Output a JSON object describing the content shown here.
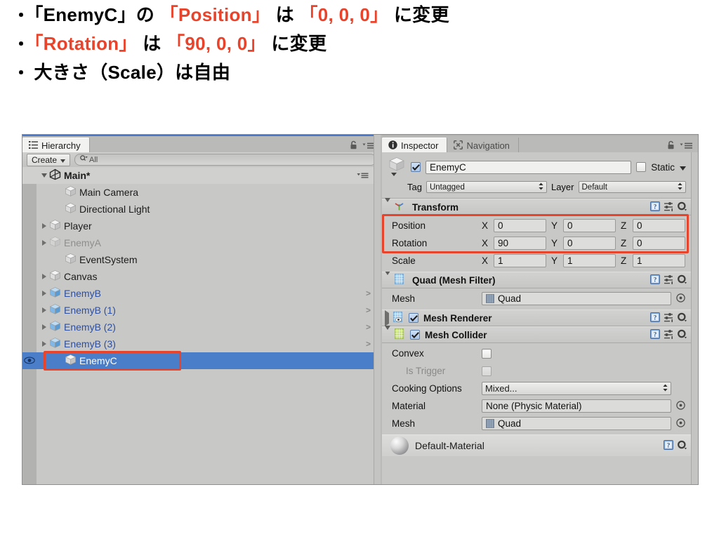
{
  "slide": {
    "lines": [
      {
        "dot": "・",
        "segments": [
          {
            "t": "「EnemyC」の ",
            "c": "black"
          },
          {
            "t": "「Position」",
            "c": "red"
          },
          {
            "t": " は ",
            "c": "black"
          },
          {
            "t": "「0, 0, 0」",
            "c": "red"
          },
          {
            "t": " に変更",
            "c": "black"
          }
        ]
      },
      {
        "dot": "・",
        "segments": [
          {
            "t": "「Rotation」",
            "c": "red"
          },
          {
            "t": " は ",
            "c": "black"
          },
          {
            "t": "「90, 0, 0」",
            "c": "red"
          },
          {
            "t": " に変更",
            "c": "black"
          }
        ]
      },
      {
        "dot": "・",
        "segments": [
          {
            "t": "大きさ（Scale）は自由",
            "c": "black"
          }
        ]
      }
    ]
  },
  "colors": {
    "accent_red": "#e8432b",
    "selection_blue": "#4a7ec8",
    "prefab_blue": "#2d4f9e",
    "panel_gray": "#c8c8c7"
  },
  "hierarchy": {
    "tab_label": "Hierarchy",
    "tab_icon": "hierarchy-icon",
    "lock_icon": "lock-icon",
    "menu_icon": "hamburger-menu-icon",
    "create_label": "Create",
    "search_placeholder": "All",
    "search_value": "All",
    "search_icon": "search-icon",
    "scene_label": "Main*",
    "items": [
      {
        "label": "Main Camera",
        "indent": 2,
        "foldout": "none",
        "style": "normal",
        "prefab_arrow": false
      },
      {
        "label": "Directional Light",
        "indent": 2,
        "foldout": "none",
        "style": "normal",
        "prefab_arrow": false
      },
      {
        "label": "Player",
        "indent": 1,
        "foldout": "right",
        "style": "normal",
        "prefab_arrow": false
      },
      {
        "label": "EnemyA",
        "indent": 1,
        "foldout": "right",
        "style": "dim",
        "prefab_arrow": false
      },
      {
        "label": "EventSystem",
        "indent": 2,
        "foldout": "none",
        "style": "normal",
        "prefab_arrow": false
      },
      {
        "label": "Canvas",
        "indent": 1,
        "foldout": "right",
        "style": "normal",
        "prefab_arrow": false
      },
      {
        "label": "EnemyB",
        "indent": 1,
        "foldout": "right",
        "style": "prefab",
        "prefab_arrow": true
      },
      {
        "label": "EnemyB (1)",
        "indent": 1,
        "foldout": "right",
        "style": "prefab",
        "prefab_arrow": true
      },
      {
        "label": "EnemyB (2)",
        "indent": 1,
        "foldout": "right",
        "style": "prefab",
        "prefab_arrow": true
      },
      {
        "label": "EnemyB (3)",
        "indent": 1,
        "foldout": "right",
        "style": "prefab",
        "prefab_arrow": true
      },
      {
        "label": "EnemyC",
        "indent": 2,
        "foldout": "none",
        "style": "selected",
        "prefab_arrow": false
      }
    ]
  },
  "inspector": {
    "tabs": [
      {
        "label": "Inspector",
        "icon": "info-icon",
        "active": true
      },
      {
        "label": "Navigation",
        "icon": "navigation-icon",
        "active": false
      }
    ],
    "lock_icon": "lock-icon",
    "menu_icon": "hamburger-menu-icon",
    "object": {
      "enabled": true,
      "name": "EnemyC",
      "static_label": "Static",
      "static_checked": false,
      "tag_label": "Tag",
      "tag_value": "Untagged",
      "layer_label": "Layer",
      "layer_value": "Default"
    },
    "components": [
      {
        "name": "Transform",
        "icon": "transform-axis-icon",
        "expanded": true,
        "has_toggle": false,
        "help_icon": "help-book-icon",
        "preset_icon": "preset-icon",
        "gear_icon": "gear-icon"
      },
      {
        "name": "Quad (Mesh Filter)",
        "icon": "mesh-filter-icon",
        "expanded": true,
        "has_toggle": false,
        "help_icon": "help-book-icon",
        "preset_icon": "preset-icon",
        "gear_icon": "gear-icon"
      },
      {
        "name": "Mesh Renderer",
        "icon": "mesh-renderer-icon",
        "expanded": false,
        "has_toggle": true,
        "toggle_checked": true,
        "help_icon": "help-book-icon",
        "preset_icon": "preset-icon",
        "gear_icon": "gear-icon"
      },
      {
        "name": "Mesh Collider",
        "icon": "mesh-collider-icon",
        "expanded": true,
        "has_toggle": true,
        "toggle_checked": true,
        "help_icon": "help-book-icon",
        "preset_icon": "preset-icon",
        "gear_icon": "gear-icon"
      }
    ],
    "transform": {
      "rows": [
        {
          "label": "Position",
          "x": "0",
          "y": "0",
          "z": "0",
          "highlighted": true
        },
        {
          "label": "Rotation",
          "x": "90",
          "y": "0",
          "z": "0",
          "highlighted": true
        },
        {
          "label": "Scale",
          "x": "1",
          "y": "1",
          "z": "1",
          "highlighted": false
        }
      ],
      "axis_x": "X",
      "axis_y": "Y",
      "axis_z": "Z"
    },
    "mesh_filter": {
      "mesh_label": "Mesh",
      "mesh_value": "Quad",
      "picker_icon": "object-picker-icon"
    },
    "mesh_collider": {
      "convex_label": "Convex",
      "convex_checked": false,
      "is_trigger_label": "Is Trigger",
      "is_trigger_checked": false,
      "cooking_label": "Cooking Options",
      "cooking_value": "Mixed...",
      "material_label": "Material",
      "material_value": "None (Physic Material)",
      "mesh_label": "Mesh",
      "mesh_value": "Quad",
      "picker_icon": "object-picker-icon"
    },
    "material_preview": {
      "name": "Default-Material",
      "help_icon": "help-book-icon",
      "gear_icon": "gear-icon"
    }
  }
}
